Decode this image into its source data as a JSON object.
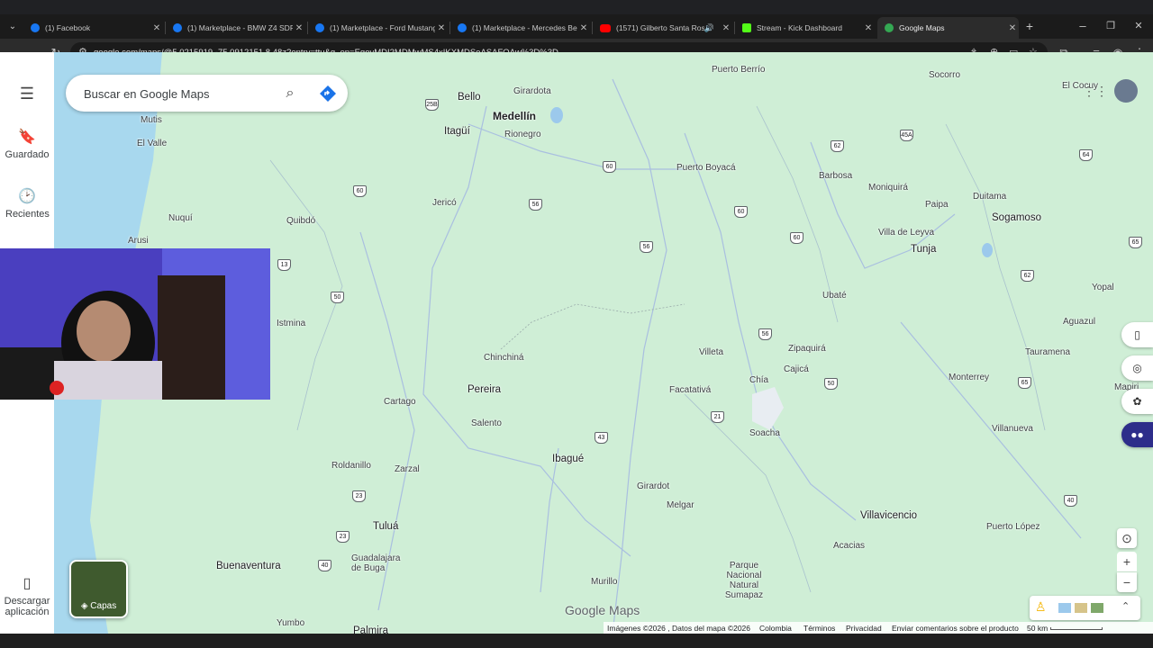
{
  "browser": {
    "tabs": [
      {
        "title": "(1) Facebook",
        "icon": "facebook-icon",
        "color": "#1877f2"
      },
      {
        "title": "(1) Marketplace - BMW Z4 SDR",
        "icon": "facebook-icon",
        "color": "#1877f2"
      },
      {
        "title": "(1) Marketplace - Ford Mustang",
        "icon": "facebook-icon",
        "color": "#1877f2"
      },
      {
        "title": "(1) Marketplace - Mercedes Be",
        "icon": "facebook-icon",
        "color": "#1877f2"
      },
      {
        "title": "(1571) Gilberto Santa Rosa",
        "icon": "youtube-icon",
        "color": "#ff0000"
      },
      {
        "title": "Stream - Kick Dashboard",
        "icon": "kick-icon",
        "color": "#53fc18"
      },
      {
        "title": "Google Maps",
        "icon": "maps-icon",
        "color": "#34a853"
      }
    ],
    "new_tab": "+",
    "url": "google.com/maps/@5.0215919,-75.0912151,8.48z?entry=ttu&g_ep=EgoyMDI2MDMwMS4xIKXMDSoASAFQAw%3D%3D"
  },
  "sidebar": {
    "menu_icon": "☰",
    "items": [
      {
        "label": "Guardado",
        "icon": "bookmark-icon"
      },
      {
        "label": "Recientes",
        "icon": "history-icon"
      },
      {
        "label": "Descargar aplicación",
        "icon": "phone-icon"
      }
    ]
  },
  "search": {
    "placeholder": "Buscar en Google Maps"
  },
  "layers": {
    "label": "Capas"
  },
  "map": {
    "places": [
      {
        "name": "Medellín",
        "size": "big"
      },
      {
        "name": "Bello"
      },
      {
        "name": "Girardota"
      },
      {
        "name": "Itagüí",
        "size": "mid"
      },
      {
        "name": "Rionegro"
      },
      {
        "name": "Puerto Berrío"
      },
      {
        "name": "Socorro"
      },
      {
        "name": "El Cocuy"
      },
      {
        "name": "Mutis"
      },
      {
        "name": "El Valle"
      },
      {
        "name": "Puerto Boyacá"
      },
      {
        "name": "Barbosa"
      },
      {
        "name": "Moniquirá"
      },
      {
        "name": "Duitama"
      },
      {
        "name": "Sogamoso",
        "size": "mid"
      },
      {
        "name": "Jericó"
      },
      {
        "name": "Nuquí"
      },
      {
        "name": "Quibdó"
      },
      {
        "name": "Arusi"
      },
      {
        "name": "Paipa"
      },
      {
        "name": "Villa de Leyva"
      },
      {
        "name": "Tunja",
        "size": "mid"
      },
      {
        "name": "Istmina"
      },
      {
        "name": "Ubaté"
      },
      {
        "name": "Yopal"
      },
      {
        "name": "Aguazul"
      },
      {
        "name": "Zipaquirá"
      },
      {
        "name": "Villeta"
      },
      {
        "name": "Cajicá"
      },
      {
        "name": "Tauramena"
      },
      {
        "name": "Chinchiná"
      },
      {
        "name": "Chía"
      },
      {
        "name": "Monterrey"
      },
      {
        "name": "Pereira",
        "size": "mid"
      },
      {
        "name": "Facatativá"
      },
      {
        "name": "Cartago"
      },
      {
        "name": "Salento"
      },
      {
        "name": "Soacha"
      },
      {
        "name": "Villanueva"
      },
      {
        "name": "Roldanillo"
      },
      {
        "name": "Zarzal"
      },
      {
        "name": "Ibagué",
        "size": "mid"
      },
      {
        "name": "Girardot"
      },
      {
        "name": "Melgar"
      },
      {
        "name": "Villavicencio",
        "size": "mid"
      },
      {
        "name": "Tuluá",
        "size": "mid"
      },
      {
        "name": "Puerto López"
      },
      {
        "name": "Acacias"
      },
      {
        "name": "Buenaventura",
        "size": "mid"
      },
      {
        "name": "Guadalajara de Buga"
      },
      {
        "name": "Parque Nacional Natural Sumapaz"
      },
      {
        "name": "Murillo"
      },
      {
        "name": "Yumbo"
      },
      {
        "name": "Palmira",
        "size": "mid"
      },
      {
        "name": "Mapiri"
      }
    ],
    "roads": [
      "25B",
      "60",
      "56",
      "62",
      "45A",
      "64",
      "60",
      "60",
      "60",
      "56",
      "13",
      "62",
      "65",
      "50",
      "56",
      "50",
      "65",
      "43",
      "21",
      "23",
      "23",
      "40",
      "40"
    ],
    "logo": "Google Maps"
  },
  "footer": {
    "imagery": "Imágenes ©2026 , Datos del mapa ©2026",
    "country": "Colombia",
    "terms": "Términos",
    "privacy": "Privacidad",
    "feedback": "Enviar comentarios sobre el producto",
    "scale": "50 km"
  },
  "colors": {
    "map_land": "#cfeed6",
    "road": "#8fa3c8",
    "water": "#9cc9ec",
    "accent": "#1a73e8"
  }
}
